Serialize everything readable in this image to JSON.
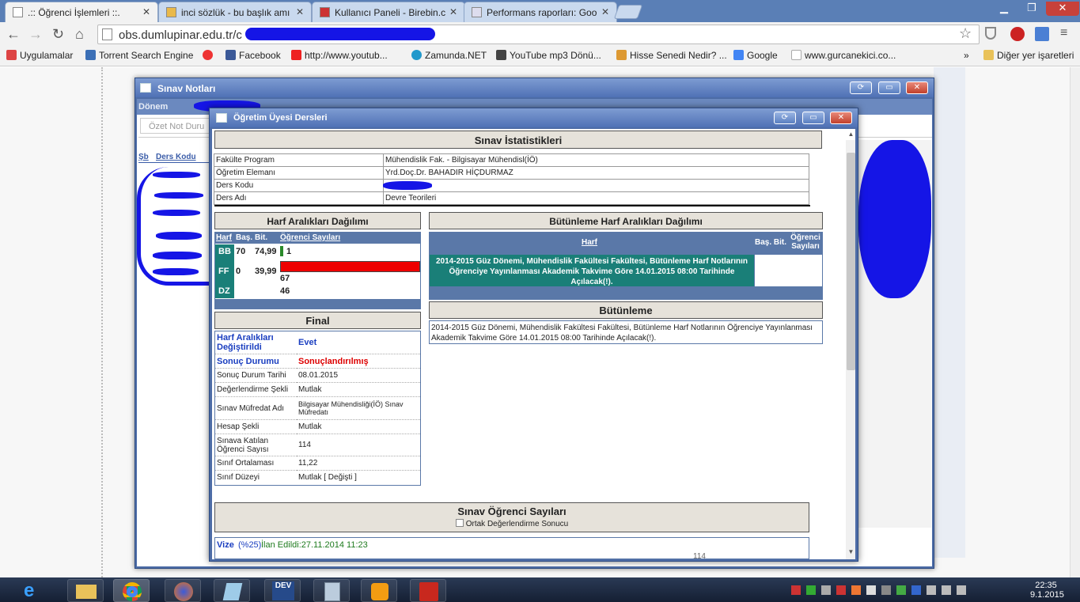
{
  "browser": {
    "tabs": [
      {
        "label": ".:: Öğrenci İşlemleri ::.",
        "active": true
      },
      {
        "label": "inci sözlük - bu başlık amı",
        "active": false
      },
      {
        "label": "Kullanıcı Paneli - Birebin.c",
        "active": false
      },
      {
        "label": "Performans raporları: Goo",
        "active": false
      }
    ],
    "url": "obs.dumlupinar.edu.tr/c",
    "bookmarks": [
      {
        "label": "Uygulamalar",
        "icon": "apps-grid-icon",
        "color": "#d44"
      },
      {
        "label": "Torrent Search Engine",
        "icon": "torrent-icon",
        "color": "#3b6fb6"
      },
      {
        "label": "",
        "icon": "flower-icon",
        "color": "#e33"
      },
      {
        "label": "Facebook",
        "icon": "facebook-icon",
        "color": "#3b5998"
      },
      {
        "label": "http://www.youtub...",
        "icon": "youtube-icon",
        "color": "#e22"
      },
      {
        "label": "Zamunda.NET",
        "icon": "zamunda-icon",
        "color": "#29c"
      },
      {
        "label": "YouTube mp3 Dönü...",
        "icon": "mp3-icon",
        "color": "#444"
      },
      {
        "label": "Hisse Senedi Nedir? ...",
        "icon": "hisse-icon",
        "color": "#d93"
      },
      {
        "label": "Google",
        "icon": "google-icon",
        "color": "#4285f4"
      },
      {
        "label": "www.gurcanekici.co...",
        "icon": "page-icon",
        "color": "#ccc"
      }
    ],
    "bookmarks_more": "»",
    "other_bookmarks": "Diğer yer işaretleri"
  },
  "outer_window": {
    "title": "Sınav Notları",
    "donem_label": "Dönem",
    "ozet_tab": "Özet Not Duru",
    "sb_label": "Şb",
    "ders_kodu_label": "Ders Kodu"
  },
  "inner_window": {
    "title": "Öğretim Üyesi Dersleri",
    "stats_header": "Sınav İstatistikleri",
    "info_rows": [
      {
        "label": "Fakülte Program",
        "value": "Mühendislik Fak. - Bilgisayar Mühendisl(İÖ)"
      },
      {
        "label": "Öğretim Elemanı",
        "value": "Yrd.Doç.Dr. BAHADIR HİÇDURMAZ"
      },
      {
        "label": "Ders Kodu",
        "value": ""
      },
      {
        "label": "Ders Adı",
        "value": "Devre Teorileri"
      }
    ],
    "harf_header": "Harf Aralıkları Dağılımı",
    "harf_cols": {
      "harf": "Harf",
      "bas": "Baş.",
      "bit": "Bit.",
      "sayi": "Öğrenci Sayıları"
    },
    "harf_rows": [
      {
        "harf": "BB",
        "bas": "70",
        "bit": "74,99",
        "sayi": "1",
        "fill": 0.02,
        "bar_color": "#2a8a2a"
      },
      {
        "harf": "FF",
        "bas": "0",
        "bit": "39,99",
        "sayi": "67",
        "fill": 1.0,
        "bar_color": "#ee0000"
      },
      {
        "harf": "DZ",
        "bas": "",
        "bit": "",
        "sayi": "46",
        "fill": 0,
        "bar_color": "#ee0000"
      }
    ],
    "but_header": "Bütünleme Harf Aralıkları Dağılımı",
    "but_cols": {
      "harf": "Harf",
      "basbit": "Baş. Bit.",
      "sayi": "Öğrenci Sayıları"
    },
    "but_notice": "2014-2015 Güz Dönemi, Mühendislik Fakültesi Fakültesi, Bütünleme Harf Notlarının Öğrenciye Yayınlanması Akademik Takvime Göre 14.01.2015 08:00 Tarihinde Açılacak(!).",
    "butunleme_header": "Bütünleme",
    "butunleme_text": "2014-2015 Güz Dönemi, Mühendislik Fakültesi Fakültesi, Bütünleme Harf Notlarının Öğrenciye Yayınlanması Akademik Takvime Göre 14.01.2015 08:00 Tarihinde Açılacak(!).",
    "final_header": "Final",
    "final_rows": [
      {
        "label": "Harf Aralıkları Değiştirildi",
        "value": "Evet",
        "style": "blue"
      },
      {
        "label": "Sonuç Durumu",
        "value": "Sonuçlandırılmış",
        "style": "red"
      },
      {
        "label": "Sonuç Durum Tarihi",
        "value": "08.01.2015",
        "style": ""
      },
      {
        "label": "Değerlendirme Şekli",
        "value": "Mutlak",
        "style": ""
      },
      {
        "label": "Sınav Müfredat Adı",
        "value": "Bilgisayar Mühendisliği(İÖ) Sınav Müfredatı",
        "style": ""
      },
      {
        "label": "Hesap Şekli",
        "value": "Mutlak",
        "style": ""
      },
      {
        "label": "Sınava Katılan Öğrenci Sayısı",
        "value": "114",
        "style": ""
      },
      {
        "label": "Sınıf Ortalaması",
        "value": "11,22",
        "style": ""
      },
      {
        "label": "Sınıf Düzeyi",
        "value": "Mutlak [ Değişti ]",
        "style": ""
      }
    ],
    "sayilar_header": "Sınav Öğrenci Sayıları",
    "ortak_label": "Ortak Değerlendirme Sonucu",
    "vize_label": "Vize",
    "vize_pct": "(%25)",
    "vize_ilan": "İlan Edildi:27.11.2014 11:23",
    "cut_value": "114"
  },
  "taskbar": {
    "time": "22:35",
    "date": "9.1.2015",
    "apps": [
      "ie-icon",
      "explorer-icon",
      "chrome-icon",
      "firefox-icon",
      "notepad-icon",
      "devcpp-icon",
      "calculator-icon",
      "media-icon",
      "pdf-icon"
    ],
    "dev_label": "DEV"
  }
}
